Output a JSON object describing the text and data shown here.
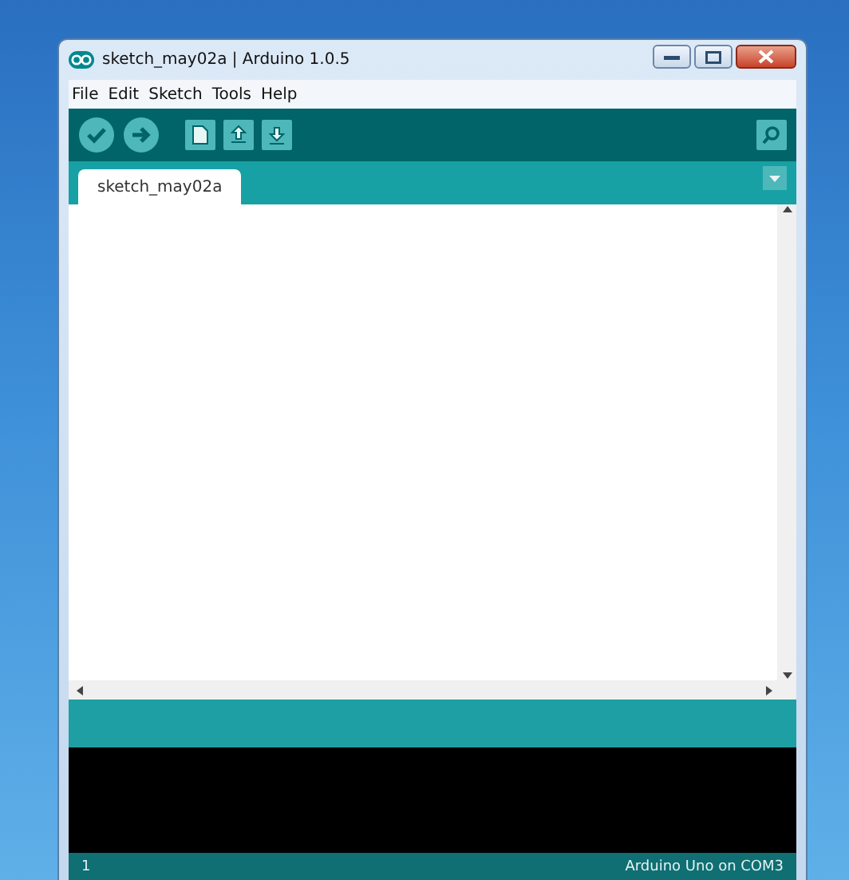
{
  "window": {
    "title": "sketch_may02a | Arduino 1.0.5"
  },
  "menu": [
    "File",
    "Edit",
    "Sketch",
    "Tools",
    "Help"
  ],
  "tabs": [
    {
      "label": "sketch_may02a",
      "selected": true
    }
  ],
  "status_bar": {
    "line": "1",
    "board": "Arduino Uno on COM3"
  }
}
